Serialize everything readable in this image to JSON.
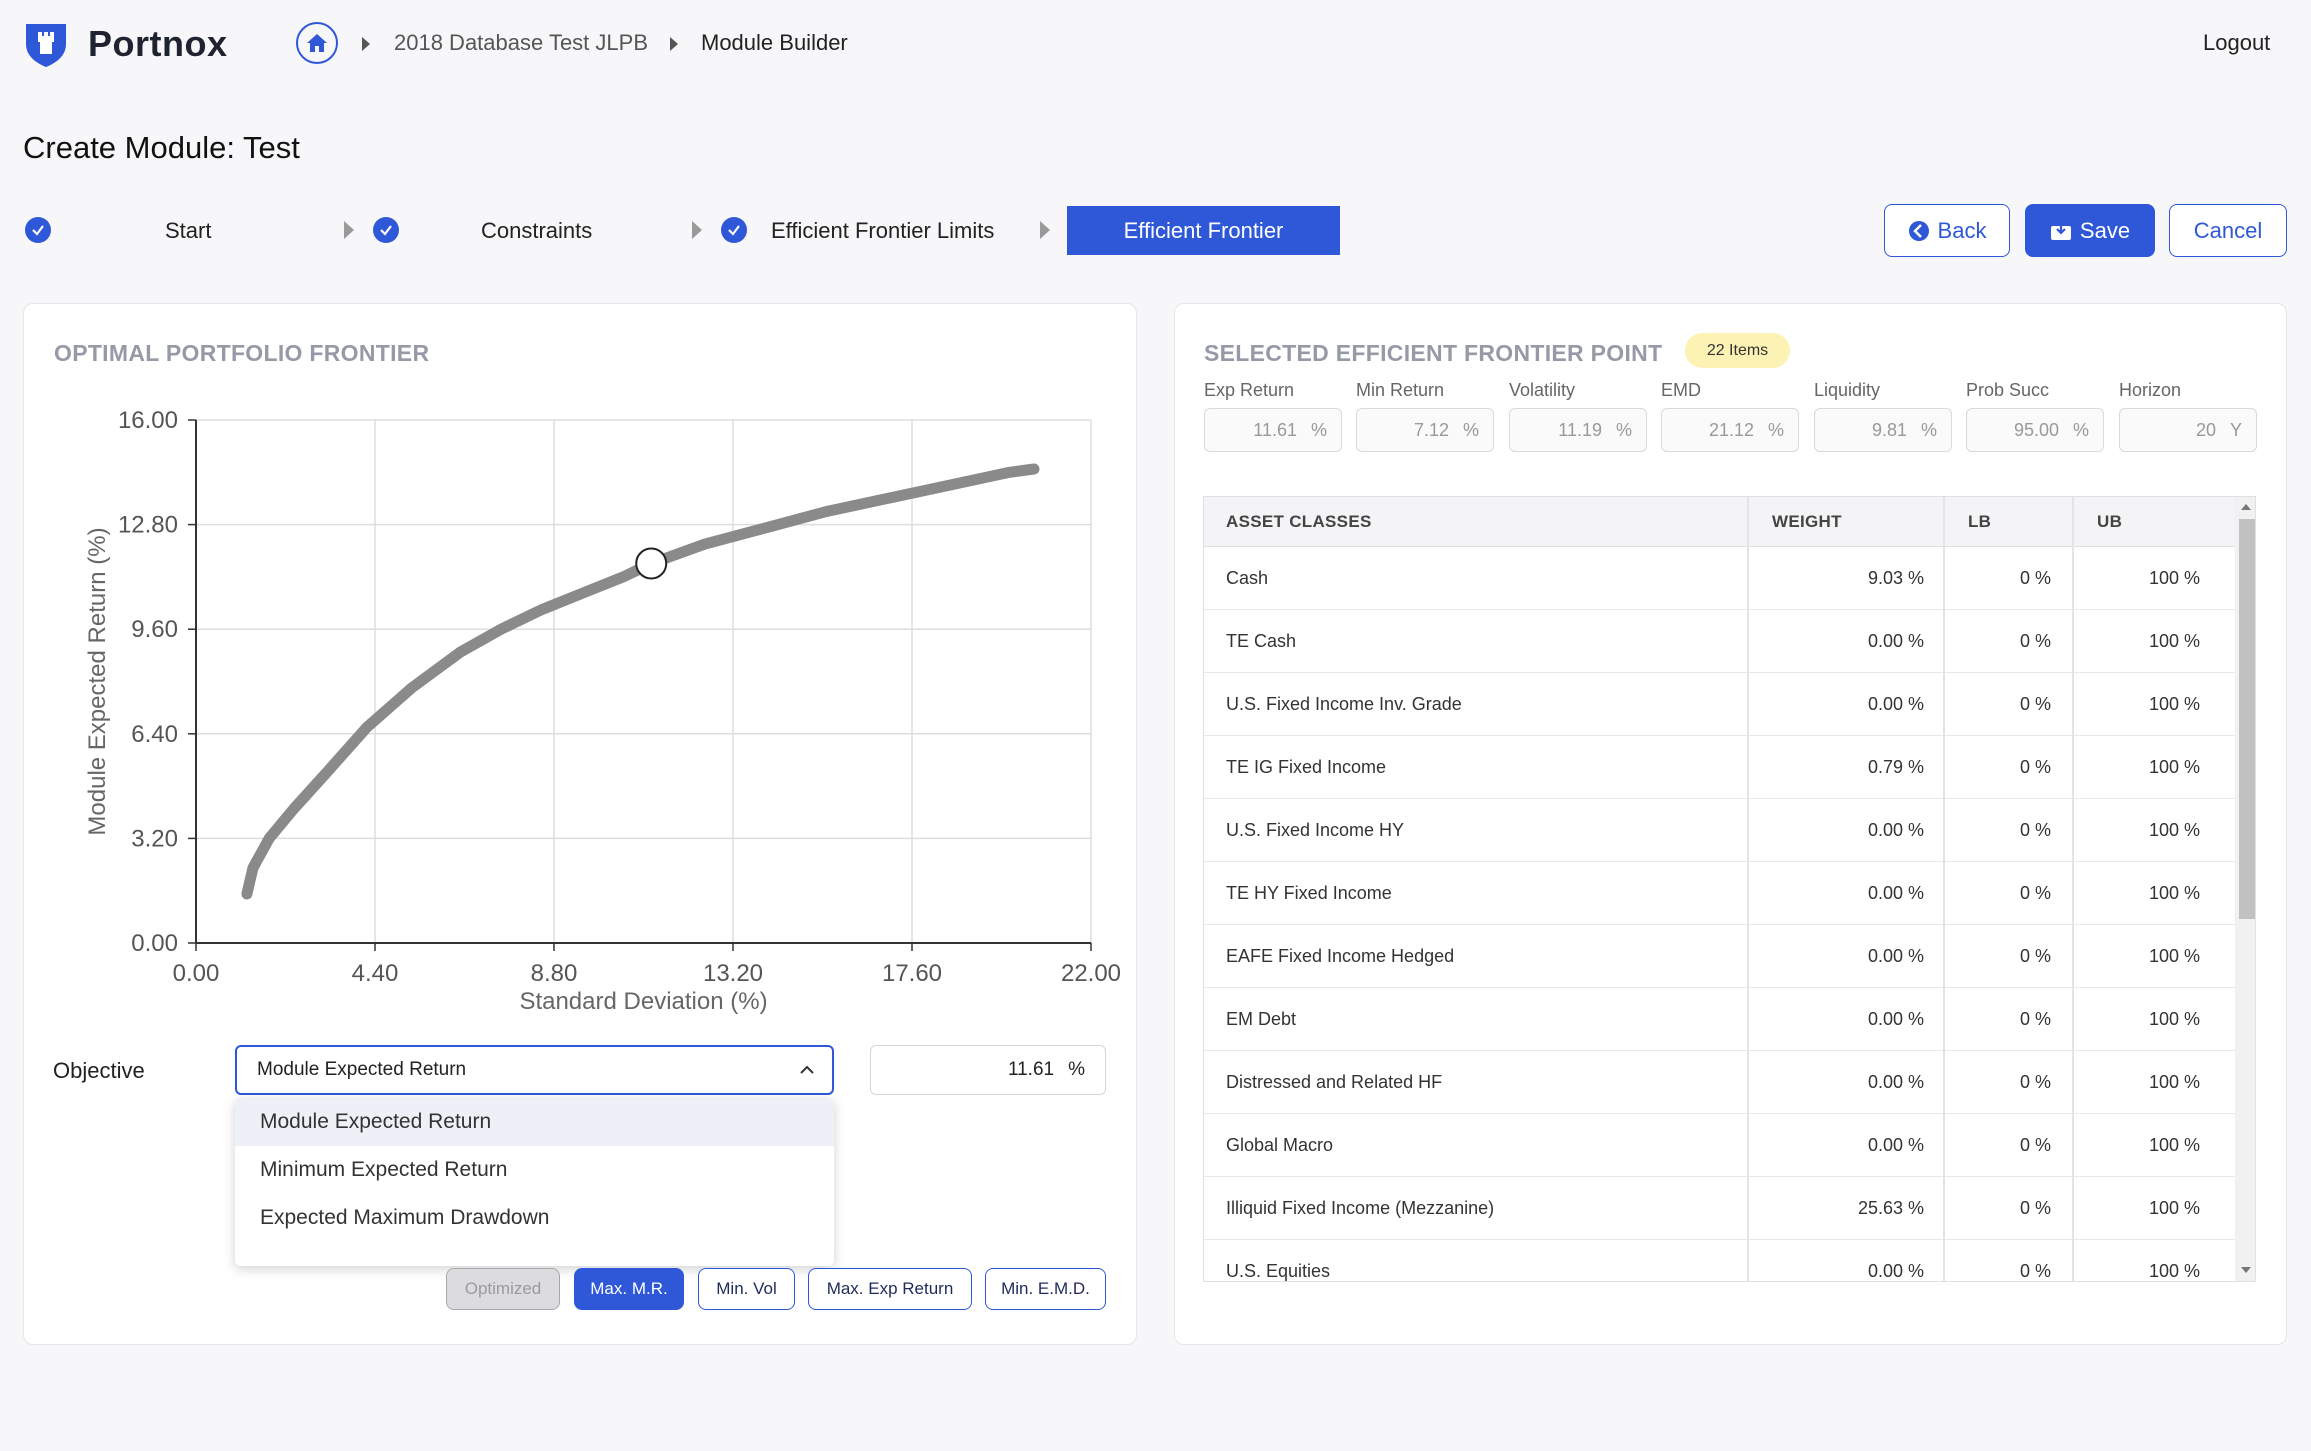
{
  "app": {
    "brand": "Portnox"
  },
  "breadcrumb": {
    "items": [
      "2018 Database Test JLPB",
      "Module Builder"
    ]
  },
  "header": {
    "logout": "Logout"
  },
  "page": {
    "title": "Create Module: Test"
  },
  "stepper": {
    "steps": [
      "Start",
      "Constraints",
      "Efficient Frontier Limits"
    ],
    "active": "Efficient Frontier"
  },
  "actions": {
    "back": "Back",
    "save": "Save",
    "cancel": "Cancel"
  },
  "left_panel": {
    "title": "OPTIMAL PORTFOLIO FRONTIER",
    "objective_label": "Objective",
    "objective_selected": "Module Expected Return",
    "objective_value": "11.61",
    "objective_unit": "%",
    "dropdown_options": [
      "Module Expected Return",
      "Minimum Expected Return",
      "Expected Maximum Drawdown"
    ],
    "buttons": {
      "optimized": "Optimized",
      "max_mr": "Max. M.R.",
      "min_vol": "Min. Vol",
      "max_exp_return": "Max. Exp Return",
      "min_emd": "Min. E.M.D."
    }
  },
  "chart_data": {
    "type": "line",
    "xlabel": "Standard Deviation (%)",
    "ylabel": "Module Expected Return (%)",
    "xlim": [
      0,
      22
    ],
    "ylim": [
      0,
      16
    ],
    "x_ticks": [
      "0.00",
      "4.40",
      "8.80",
      "13.20",
      "17.60",
      "22.00"
    ],
    "y_ticks": [
      "0.00",
      "3.20",
      "6.40",
      "9.60",
      "12.80",
      "16.00"
    ],
    "grid": true,
    "series": [
      {
        "x": [
          1.25,
          1.4,
          1.8,
          2.4,
          3.2,
          4.2,
          5.3,
          6.5,
          7.5,
          8.5,
          9.5,
          10.5,
          11.19,
          12.5,
          14.0,
          15.5,
          17.0,
          18.5,
          20.0,
          20.6
        ],
        "y": [
          1.5,
          2.3,
          3.2,
          4.1,
          5.2,
          6.6,
          7.8,
          8.9,
          9.6,
          10.2,
          10.7,
          11.2,
          11.61,
          12.2,
          12.7,
          13.2,
          13.6,
          14.0,
          14.4,
          14.5
        ],
        "color": "#8a8a8a"
      }
    ],
    "selected_point": {
      "x": 11.19,
      "y": 11.61
    }
  },
  "right_panel": {
    "title": "SELECTED EFFICIENT FRONTIER POINT",
    "badge": "22 Items",
    "stats": [
      {
        "label": "Exp Return",
        "value": "11.61",
        "unit": "%"
      },
      {
        "label": "Min Return",
        "value": "7.12",
        "unit": "%"
      },
      {
        "label": "Volatility",
        "value": "11.19",
        "unit": "%"
      },
      {
        "label": "EMD",
        "value": "21.12",
        "unit": "%"
      },
      {
        "label": "Liquidity",
        "value": "9.81",
        "unit": "%"
      },
      {
        "label": "Prob Succ",
        "value": "95.00",
        "unit": "%"
      },
      {
        "label": "Horizon",
        "value": "20",
        "unit": "Y"
      }
    ],
    "table": {
      "headers": [
        "ASSET CLASSES",
        "WEIGHT",
        "LB",
        "UB"
      ],
      "rows": [
        [
          "Cash",
          "9.03 %",
          "0 %",
          "100 %"
        ],
        [
          "TE Cash",
          "0.00 %",
          "0 %",
          "100 %"
        ],
        [
          "U.S. Fixed Income Inv. Grade",
          "0.00 %",
          "0 %",
          "100 %"
        ],
        [
          "TE IG Fixed Income",
          "0.79 %",
          "0 %",
          "100 %"
        ],
        [
          "U.S. Fixed Income HY",
          "0.00 %",
          "0 %",
          "100 %"
        ],
        [
          "TE HY Fixed Income",
          "0.00 %",
          "0 %",
          "100 %"
        ],
        [
          "EAFE Fixed Income Hedged",
          "0.00 %",
          "0 %",
          "100 %"
        ],
        [
          "EM Debt",
          "0.00 %",
          "0 %",
          "100 %"
        ],
        [
          "Distressed and Related HF",
          "0.00 %",
          "0 %",
          "100 %"
        ],
        [
          "Global Macro",
          "0.00 %",
          "0 %",
          "100 %"
        ],
        [
          "Illiquid Fixed Income (Mezzanine)",
          "25.63 %",
          "0 %",
          "100 %"
        ],
        [
          "U.S. Equities",
          "0.00 %",
          "0 %",
          "100 %"
        ]
      ]
    }
  },
  "colors": {
    "accent": "#2f58d8",
    "badge": "#fcf2b3",
    "curve": "#8a8a8a"
  }
}
